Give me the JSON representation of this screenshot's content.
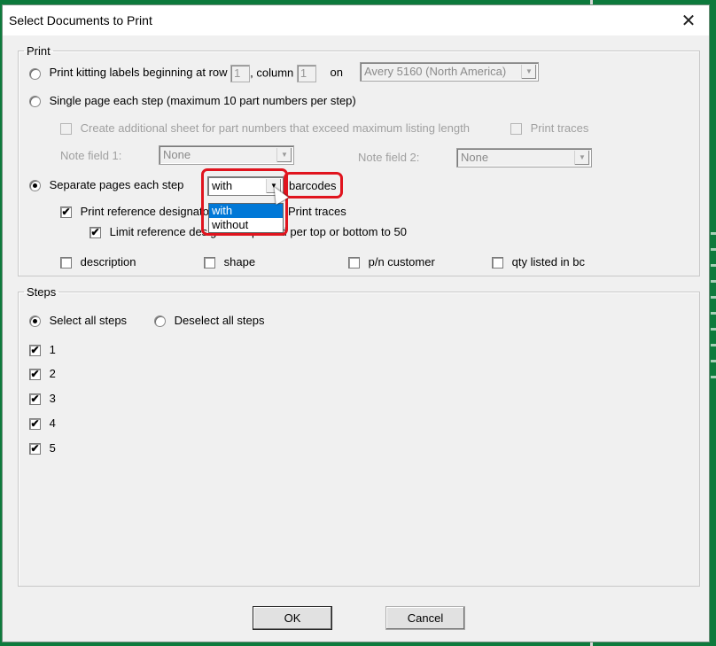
{
  "window": {
    "title": "Select Documents to Print",
    "close_icon": "close-icon"
  },
  "print_group": {
    "legend": "Print",
    "kitting": {
      "label_prefix": "Print kitting labels beginning at row",
      "row_value": "1",
      "column_label": ", column",
      "column_value": "1",
      "on_label": "on",
      "label_type": "Avery 5160 (North America)",
      "selected": false
    },
    "single_page": {
      "label": "Single page each step (maximum 10 part numbers per step)",
      "selected": false,
      "additional_sheet_label": "Create additional sheet for part numbers that exceed maximum listing length",
      "additional_sheet_checked": false,
      "print_traces_label": "Print traces",
      "print_traces_checked": false,
      "note_field_1_label": "Note field 1:",
      "note_field_1_value": "None",
      "note_field_2_label": "Note field 2:",
      "note_field_2_value": "None"
    },
    "separate_pages": {
      "label": "Separate pages each step",
      "selected": true,
      "barcode_combo_value": "with",
      "barcode_options": [
        "with",
        "without"
      ],
      "barcode_selected_option": "with",
      "barcodes_label": "barcodes",
      "print_ref_designators_label": "Print reference designators",
      "print_ref_designators_checked": true,
      "print_traces_label": "Print traces",
      "limit_ref_label": "Limit reference designators printed per top or bottom to 50",
      "limit_ref_checked": true
    },
    "extras": [
      {
        "label": "description",
        "checked": false
      },
      {
        "label": "shape",
        "checked": false
      },
      {
        "label": "p/n customer",
        "checked": false
      },
      {
        "label": "qty listed in bc",
        "checked": false
      }
    ]
  },
  "steps_group": {
    "legend": "Steps",
    "select_all_label": "Select all steps",
    "select_all_selected": true,
    "deselect_all_label": "Deselect all steps",
    "steps": [
      {
        "label": "1",
        "checked": true
      },
      {
        "label": "2",
        "checked": true
      },
      {
        "label": "3",
        "checked": true
      },
      {
        "label": "4",
        "checked": true
      },
      {
        "label": "5",
        "checked": true
      }
    ]
  },
  "buttons": {
    "ok_label": "OK",
    "cancel_label": "Cancel"
  },
  "glyphs": {
    "check": "✔",
    "close": "✕",
    "dropdown": "▼"
  },
  "colors": {
    "highlight": "#e0141e",
    "selection": "#0078d7",
    "background": "#0d7a3c"
  }
}
